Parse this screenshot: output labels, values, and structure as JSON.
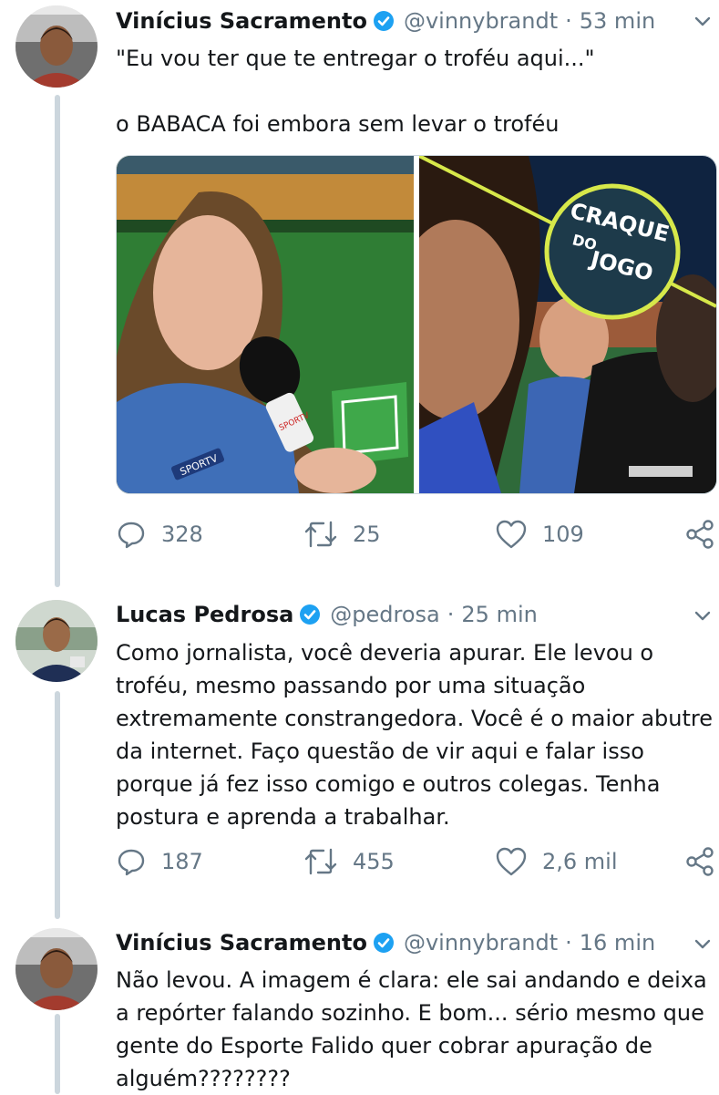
{
  "colors": {
    "accent": "#1da1f2",
    "text": "#14171a",
    "muted": "#657786",
    "thread": "#ccd6dd"
  },
  "tweets": [
    {
      "name": "Vinícius Sacramento",
      "handle": "@vinnybrandt",
      "dot": "·",
      "time": "53 min",
      "verified": true,
      "text_lines": [
        "\"Eu vou ter que te entregar o troféu aqui...\"",
        "",
        "o BABACA foi embora sem levar o troféu"
      ],
      "media": {
        "left_photo": "reporter-interview",
        "right_photo": "craque-do-jogo",
        "badge_lines": [
          "CRAQUE",
          "DO",
          "JOGO"
        ],
        "mic_logo": "SPORTV",
        "shirt_logo": "SPORTV"
      },
      "stats": {
        "replies": "328",
        "retweets": "25",
        "likes": "109"
      }
    },
    {
      "name": "Lucas Pedrosa",
      "handle": "@pedrosa",
      "dot": "·",
      "time": "25 min",
      "verified": true,
      "text_lines": [
        "Como jornalista, você deveria apurar. Ele levou o",
        "troféu, mesmo passando por uma situação",
        "extremamente constrangedora. Você é o maior abutre",
        "da internet. Faço questão de vir aqui e falar isso",
        "porque já fez isso comigo e outros colegas. Tenha",
        "postura e aprenda a trabalhar."
      ],
      "stats": {
        "replies": "187",
        "retweets": "455",
        "likes": "2,6 mil"
      }
    },
    {
      "name": "Vinícius Sacramento",
      "handle": "@vinnybrandt",
      "dot": "·",
      "time": "16 min",
      "verified": true,
      "text_lines": [
        "Não levou. A imagem é clara: ele sai andando e deixa",
        "a repórter falando sozinho. E bom... sério mesmo que",
        "gente do Esporte Falido quer cobrar apuração de",
        "alguém????????"
      ]
    }
  ]
}
